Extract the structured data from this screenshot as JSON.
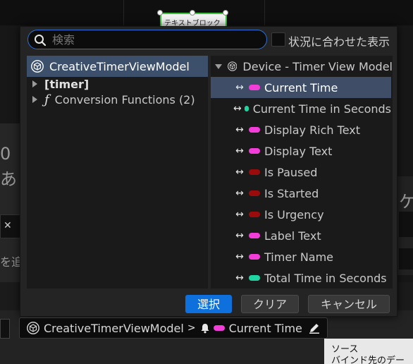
{
  "background": {
    "left_texts": [
      "0",
      "あ",
      "を追"
    ],
    "right_text": "ケ",
    "left_box_icon": "x-icon",
    "widget_label": "テキストブロック",
    "tooltip": {
      "line1": "ソース",
      "line2": "バインド先のデー"
    }
  },
  "dialog": {
    "search": {
      "placeholder": "検索",
      "value": ""
    },
    "context_label": "状況に合わせた表示",
    "context_checked": false,
    "left_tree": [
      {
        "label": "CreativeTimerViewModel",
        "icon": "cube-icon",
        "selected": true,
        "kind": "viewmodel"
      },
      {
        "label": "[timer]",
        "kind": "category",
        "expanded": false
      },
      {
        "label": "Conversion Functions (2)",
        "kind": "functions",
        "expanded": false
      }
    ],
    "right_header": {
      "label": "Device - Timer View Model",
      "icon": "cube-icon",
      "expanded": true
    },
    "properties": [
      {
        "label": "Current Time",
        "color": "#f23dd9",
        "selected": true
      },
      {
        "label": "Current Time in Seconds",
        "color": "#1fd6a2",
        "selected": false
      },
      {
        "label": "Display Rich Text",
        "color": "#f23dd9",
        "selected": false
      },
      {
        "label": "Display Text",
        "color": "#f23dd9",
        "selected": false
      },
      {
        "label": "Is Paused",
        "color": "#9a0c0c",
        "selected": false
      },
      {
        "label": "Is Started",
        "color": "#9a0c0c",
        "selected": false
      },
      {
        "label": "Is Urgency",
        "color": "#9a0c0c",
        "selected": false
      },
      {
        "label": "Label Text",
        "color": "#f23dd9",
        "selected": false
      },
      {
        "label": "Timer Name",
        "color": "#f23dd9",
        "selected": false
      },
      {
        "label": "Total Time in Seconds",
        "color": "#1fd6a2",
        "selected": false
      }
    ],
    "buttons": {
      "select": "選択",
      "clear": "クリア",
      "cancel": "キャンセル"
    }
  },
  "binding": {
    "viewmodel": "CreativeTimerViewModel",
    "separator": ">",
    "property": "Current Time",
    "property_color": "#f23dd9"
  },
  "colors": {
    "accent": "#0e70dc",
    "selection": "#3f4e66",
    "text_pill": "#f23dd9",
    "number_pill": "#1fd6a2",
    "bool_pill": "#9a0c0c"
  }
}
